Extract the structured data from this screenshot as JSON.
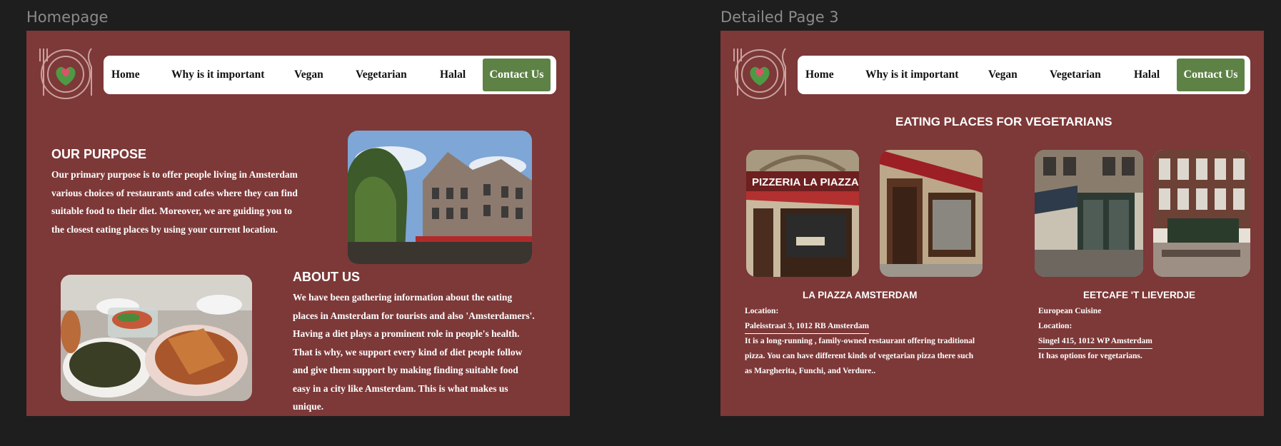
{
  "frames": {
    "homepage_label": "Homepage",
    "detail_label": "Detailed Page 3"
  },
  "colors": {
    "canvas": "#1e1e1e",
    "frame_bg": "#7d3838",
    "nav_bg": "#ffffff",
    "contact_bg": "#5e8246",
    "text": "#ffffff"
  },
  "nav": {
    "home": "Home",
    "why": "Why is it important",
    "vegan": "Vegan",
    "vegetarian": "Vegetarian",
    "halal": "Halal",
    "contact": "Contact Us"
  },
  "homepage": {
    "purpose": {
      "title": "OUR PURPOSE",
      "lines": [
        "Our primary purpose is to offer people living in Amsterdam",
        "various choices of restaurants and cafes where they can find",
        "suitable food to their diet. Moreover, we are guiding you to",
        "the closest eating places by using your current location."
      ]
    },
    "about": {
      "title": "ABOUT US",
      "lines": [
        "We have been gathering information about the eating",
        "places in Amsterdam for tourists and also 'Amsterdamers'.",
        "Having a diet plays a prominent role in people's health.",
        "That is why, we support  every kind of diet people follow",
        "and give them support by making finding suitable food",
        "easy  in a city like Amsterdam. This is what makes us",
        "unique."
      ]
    }
  },
  "detail": {
    "title": "EATING PLACES FOR VEGETARIANS",
    "place1": {
      "name": "LA PIAZZA AMSTERDAM",
      "location_label": "Location:",
      "address": "Paleisstraat 3, 1012 RB Amsterdam",
      "desc": [
        "It is a long-running , family-owned restaurant offering traditional",
        "pizza.   You can have different kinds of vegetarian pizza there such",
        "as Margherita, Funchi, and Verdure.."
      ],
      "sign_text": "PIZZERIA LA PIAZZA"
    },
    "place2": {
      "name": "EETCAFE 'T LIEVERDJE",
      "cuisine": "European Cuisine",
      "location_label": "Location:",
      "address": "Singel 415, 1012 WP Amsterdam",
      "note": "It has options for vegetarians."
    }
  }
}
